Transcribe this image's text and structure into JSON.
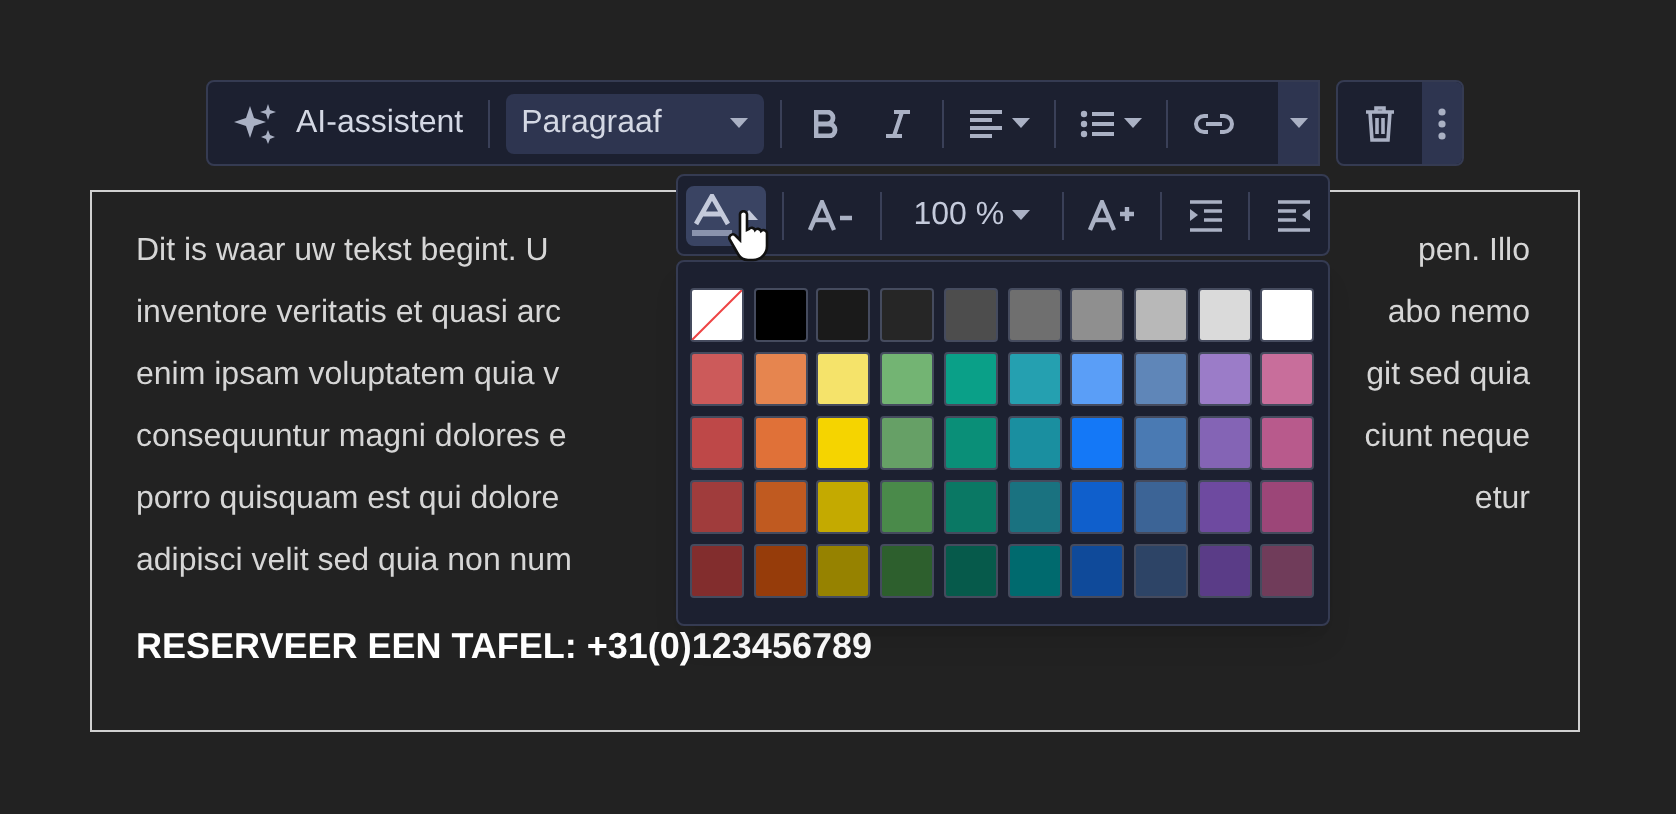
{
  "toolbar": {
    "ai_label": "AI-assistent",
    "block_style": "Paragraaf"
  },
  "format_bar": {
    "tools": [
      {
        "kind": "text-color",
        "selected": true
      },
      {
        "kind": "size-down",
        "selected": false
      },
      {
        "kind": "size",
        "label": "100 %",
        "selected": false
      },
      {
        "kind": "size-up",
        "selected": false
      },
      {
        "kind": "indent",
        "selected": false
      },
      {
        "kind": "outdent",
        "selected": false
      }
    ]
  },
  "swatches": [
    {
      "kind": "none"
    },
    {
      "kind": "color",
      "color": "#000000"
    },
    {
      "kind": "color",
      "color": "#1a1a1a"
    },
    {
      "kind": "color",
      "color": "#262626"
    },
    {
      "kind": "color",
      "color": "#4d4d4d"
    },
    {
      "kind": "color",
      "color": "#6f6f6f"
    },
    {
      "kind": "color",
      "color": "#8f8f8f"
    },
    {
      "kind": "color",
      "color": "#b8b8b8"
    },
    {
      "kind": "color",
      "color": "#dadada"
    },
    {
      "kind": "color",
      "color": "#ffffff"
    },
    {
      "kind": "color",
      "color": "#cc5a5a"
    },
    {
      "kind": "color",
      "color": "#e6854f"
    },
    {
      "kind": "color",
      "color": "#f5e36a"
    },
    {
      "kind": "color",
      "color": "#73b473"
    },
    {
      "kind": "color",
      "color": "#0aa088"
    },
    {
      "kind": "color",
      "color": "#25a0b0"
    },
    {
      "kind": "color",
      "color": "#5a9ef7"
    },
    {
      "kind": "color",
      "color": "#5f86b8"
    },
    {
      "kind": "color",
      "color": "#9b7cc8"
    },
    {
      "kind": "color",
      "color": "#c86e9b"
    },
    {
      "kind": "color",
      "color": "#be4848"
    },
    {
      "kind": "color",
      "color": "#e07138"
    },
    {
      "kind": "color",
      "color": "#f5d400"
    },
    {
      "kind": "color",
      "color": "#66a066"
    },
    {
      "kind": "color",
      "color": "#0a8f78"
    },
    {
      "kind": "color",
      "color": "#1a8fa0"
    },
    {
      "kind": "color",
      "color": "#1478f7"
    },
    {
      "kind": "color",
      "color": "#4a7ab3"
    },
    {
      "kind": "color",
      "color": "#8464b5"
    },
    {
      "kind": "color",
      "color": "#b85a8c"
    },
    {
      "kind": "color",
      "color": "#a03c3c"
    },
    {
      "kind": "color",
      "color": "#c05a20"
    },
    {
      "kind": "color",
      "color": "#c4aa00"
    },
    {
      "kind": "color",
      "color": "#4a8a4a"
    },
    {
      "kind": "color",
      "color": "#0a7864"
    },
    {
      "kind": "color",
      "color": "#1a7280"
    },
    {
      "kind": "color",
      "color": "#0f5fcc"
    },
    {
      "kind": "color",
      "color": "#3c6496"
    },
    {
      "kind": "color",
      "color": "#6e4aa0"
    },
    {
      "kind": "color",
      "color": "#9c4678"
    },
    {
      "kind": "color",
      "color": "#822d2d"
    },
    {
      "kind": "color",
      "color": "#963c0a"
    },
    {
      "kind": "color",
      "color": "#968200"
    },
    {
      "kind": "color",
      "color": "#2d5f2d"
    },
    {
      "kind": "color",
      "color": "#065a4b"
    },
    {
      "kind": "color",
      "color": "#006a6e"
    },
    {
      "kind": "color",
      "color": "#0f4a9a"
    },
    {
      "kind": "color",
      "color": "#2d4466"
    },
    {
      "kind": "color",
      "color": "#5a3c87"
    },
    {
      "kind": "color",
      "color": "#703c5a"
    }
  ],
  "editor": {
    "lines": [
      {
        "left": "Dit is waar uw tekst begint. U",
        "right": "pen. Illo"
      },
      {
        "left": "inventore veritatis et quasi arc",
        "right": "abo nemo"
      },
      {
        "left": "enim ipsam voluptatem quia v",
        "right": "git sed quia"
      },
      {
        "left": "consequuntur magni dolores e",
        "right": "ciunt neque"
      },
      {
        "left": "porro quisquam est qui dolore",
        "right": "etur"
      },
      {
        "left": "adipisci velit sed quia non num"
      }
    ],
    "heading": "RESERVEER EEN TAFEL: +31(0)123456789"
  }
}
